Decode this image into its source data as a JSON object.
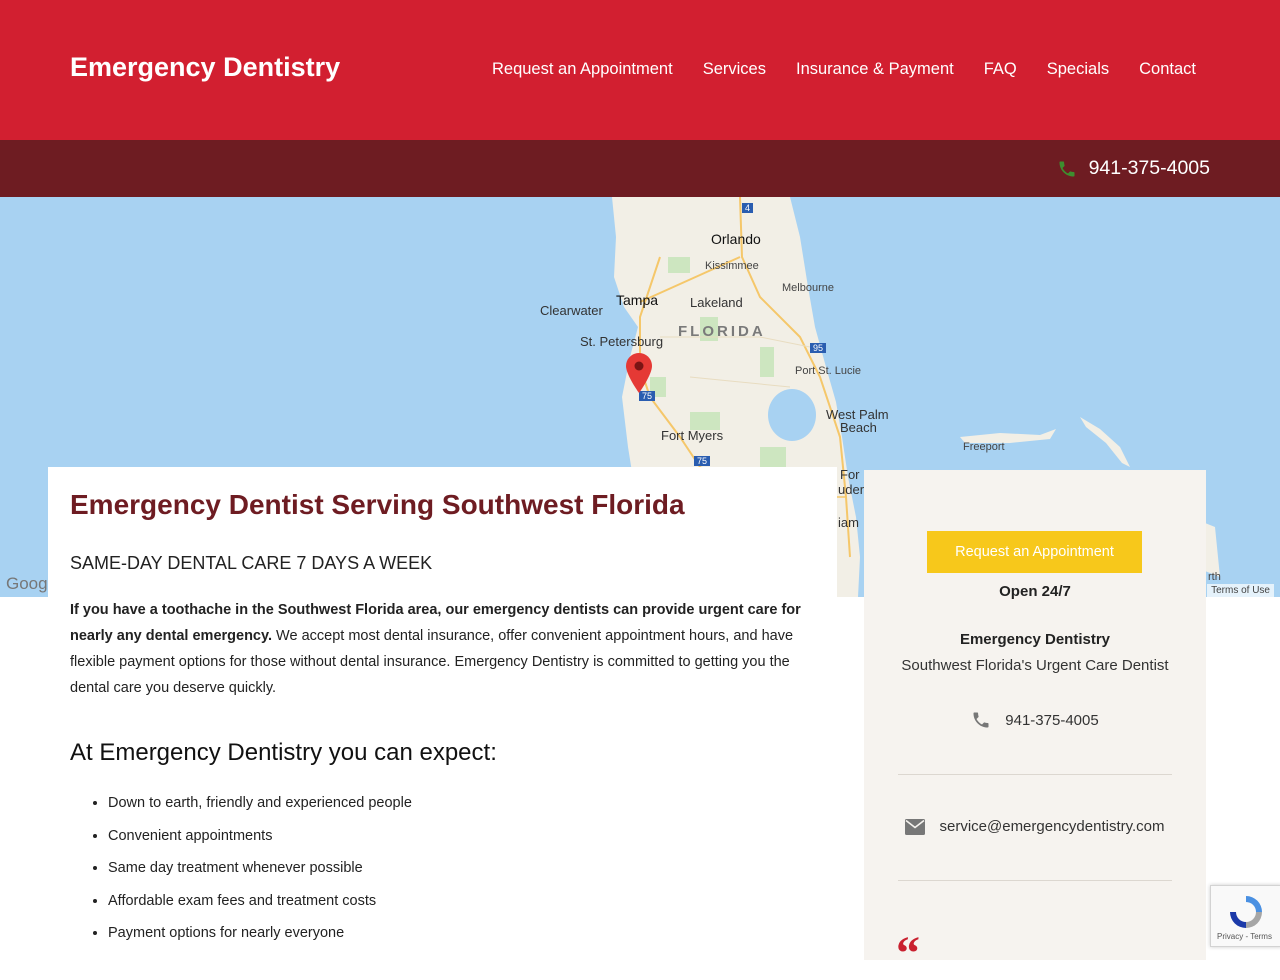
{
  "header": {
    "brand": "Emergency Dentistry",
    "nav": [
      "Request an Appointment",
      "Services",
      "Insurance & Payment",
      "FAQ",
      "Specials",
      "Contact"
    ],
    "phone": "941-375-4005"
  },
  "map": {
    "labels": {
      "orlando": "Orlando",
      "kissimmee": "Kissimmee",
      "melbourne": "Melbourne",
      "clearwater": "Clearwater",
      "tampa": "Tampa",
      "lakeland": "Lakeland",
      "florida": "FLORIDA",
      "st_petersburg": "St. Petersburg",
      "port_st_lucie": "Port St. Lucie",
      "west_palm": "West Palm",
      "beach": "Beach",
      "fort_myers": "Fort Myers",
      "freeport": "Freeport",
      "fort_partial": "For",
      "lauder_partial": "uder",
      "miami_partial": "iam",
      "rth_partial": "rth"
    },
    "shields": {
      "i4": "4",
      "i95": "95",
      "i75a": "75",
      "i75b": "75"
    },
    "google": "Goog",
    "terms": "Terms of Use"
  },
  "main": {
    "title": "Emergency Dentist Serving Southwest Florida",
    "subtitle": "SAME-DAY DENTAL CARE 7 DAYS A WEEK",
    "intro_bold": "If you have a toothache in the Southwest Florida area, our emergency dentists can provide urgent care for nearly any dental emergency.",
    "intro_rest": " We accept most dental insurance, offer convenient appointment hours, and have flexible payment options for those without dental insurance. Emergency Dentistry is committed to getting you the dental care you deserve quickly.",
    "expect_heading": "At Emergency Dentistry you can expect:",
    "expect_items": [
      "Down to earth, friendly and experienced people",
      "Convenient appointments",
      "Same day treatment whenever possible",
      "Affordable exam fees and treatment costs",
      "Payment options for nearly everyone"
    ]
  },
  "sidebar": {
    "appointment_button": "Request an Appointment",
    "hours": "Open 24/7",
    "business_name": "Emergency Dentistry",
    "tagline": "Southwest Florida's Urgent Care Dentist",
    "phone": "941-375-4005",
    "email": "service@emergencydentistry.com",
    "quote_glyph": "“"
  },
  "recaptcha": {
    "links": "Privacy - Terms"
  },
  "colors": {
    "header_red": "#d21f30",
    "phonebar_maroon": "#6e1c22",
    "title_maroon": "#6e1c22",
    "button_yellow": "#f7c81b",
    "phone_icon_green": "#3e8e2f"
  }
}
